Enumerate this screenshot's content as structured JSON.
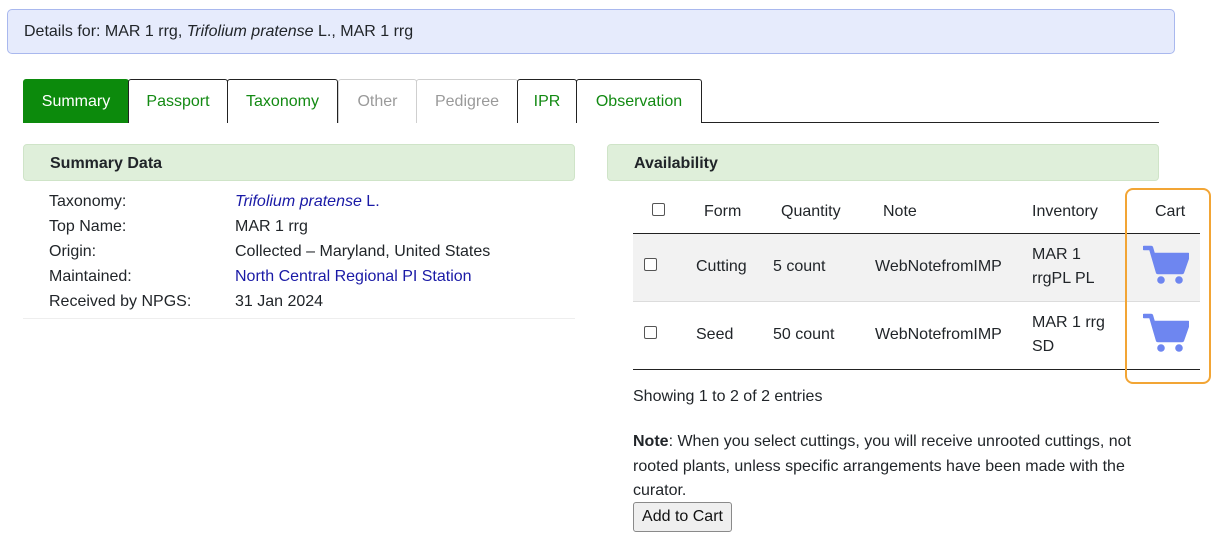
{
  "details": {
    "prefix": "Details for: MAR 1 rrg, ",
    "species": "Trifolium pratense",
    "suffix": " L., MAR 1 rrg"
  },
  "tabs": [
    {
      "label": "Summary",
      "state": "active"
    },
    {
      "label": "Passport",
      "state": "normal"
    },
    {
      "label": "Taxonomy",
      "state": "normal"
    },
    {
      "label": "Other",
      "state": "disabled"
    },
    {
      "label": "Pedigree",
      "state": "disabled"
    },
    {
      "label": "IPR",
      "state": "normal"
    },
    {
      "label": "Observation",
      "state": "normal"
    }
  ],
  "summary": {
    "heading": "Summary Data",
    "rows": [
      {
        "label": "Taxonomy:",
        "value_italic": "Trifolium pratense",
        "value": " L."
      },
      {
        "label": "Top Name:",
        "value": "MAR 1 rrg"
      },
      {
        "label": "Origin:",
        "value": "Collected – Maryland, United States"
      },
      {
        "label": "Maintained:",
        "value": "North Central Regional PI Station"
      },
      {
        "label": "Received by NPGS:",
        "value": "31 Jan 2024"
      }
    ]
  },
  "availability": {
    "heading": "Availability",
    "columns": [
      "Form",
      "Quantity",
      "Note",
      "Inventory",
      "Cart"
    ],
    "rows": [
      {
        "form": "Cutting",
        "quantity": "5 count",
        "note": "WebNotefromIMP",
        "inventory_line1": "MAR 1",
        "inventory_line2": "rrgPL PL"
      },
      {
        "form": "Seed",
        "quantity": "50 count",
        "note": "WebNotefromIMP",
        "inventory_line1": "MAR 1 rrg",
        "inventory_line2": "SD"
      }
    ],
    "showing": "Showing 1 to 2 of 2 entries",
    "note_label": "Note",
    "note_text": ": When you select cuttings, you will receive unrooted cuttings, not rooted plants, unless specific arrangements have been made with the curator.",
    "add_to_cart_label": "Add to Cart"
  },
  "icons": {
    "cart": "shopping-cart-icon"
  },
  "colors": {
    "details_bg": "#e6ebfc",
    "active_tab": "#0c8a0c",
    "tab_link": "#138a13",
    "panel_header": "#dfefda",
    "link": "#1a1aa6",
    "cart_icon": "#6e86f0",
    "highlight": "#f2a535"
  }
}
